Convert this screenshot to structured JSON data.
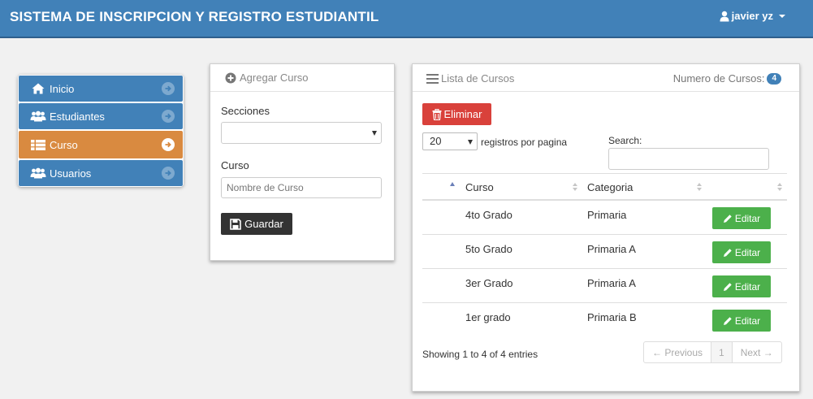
{
  "navbar": {
    "title": "SISTEMA DE INSCRIPCION Y REGISTRO ESTUDIANTIL",
    "user": "javier yz"
  },
  "sidebar": {
    "items": [
      {
        "label": "Inicio",
        "icon": "home-icon"
      },
      {
        "label": "Estudiantes",
        "icon": "users-icon"
      },
      {
        "label": "Curso",
        "icon": "table-list-icon",
        "active": true
      },
      {
        "label": "Usuarios",
        "icon": "users-icon"
      }
    ]
  },
  "form": {
    "title": "Agregar Curso",
    "secciones_label": "Secciones",
    "secciones_value": "",
    "curso_label": "Curso",
    "curso_placeholder": "Nombre de Curso",
    "save_label": "Guardar"
  },
  "list": {
    "title": "Lista de Cursos",
    "count_label": "Numero de Cursos:",
    "count": "4",
    "delete_label": "Eliminar",
    "page_length": "20",
    "page_length_suffix": "registros por pagina",
    "search_label": "Search:",
    "search_value": "",
    "columns": [
      "Curso",
      "Categoria"
    ],
    "rows": [
      {
        "curso": "4to Grado",
        "categoria": "Primaria",
        "action": "Editar"
      },
      {
        "curso": "5to Grado",
        "categoria": "Primaria A",
        "action": "Editar"
      },
      {
        "curso": "3er Grado",
        "categoria": "Primaria A",
        "action": "Editar"
      },
      {
        "curso": "1er grado",
        "categoria": "Primaria B",
        "action": "Editar"
      }
    ],
    "info": "Showing 1 to 4 of 4 entries",
    "pagination": {
      "previous": "← Previous",
      "current": "1",
      "next": "Next →"
    }
  },
  "colors": {
    "primary": "#4181b8",
    "active": "#d98a40",
    "danger": "#d9413b",
    "success": "#4cb04b",
    "dark": "#333333"
  }
}
